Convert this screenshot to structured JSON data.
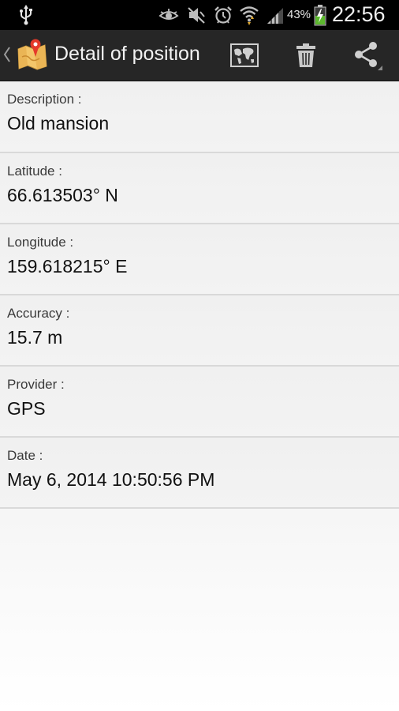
{
  "status_bar": {
    "battery_percent": "43%",
    "time": "22:56",
    "icons": [
      "usb-icon",
      "eye-icon",
      "mute-icon",
      "alarm-icon",
      "wifi-icon",
      "signal-icon",
      "battery-icon"
    ]
  },
  "action_bar": {
    "title": "Detail of position",
    "actions": [
      "map-icon",
      "trash-icon",
      "share-icon"
    ]
  },
  "details": [
    {
      "label": "Description :",
      "value": "Old mansion"
    },
    {
      "label": "Latitude :",
      "value": "66.613503° N"
    },
    {
      "label": "Longitude :",
      "value": "159.618215° E"
    },
    {
      "label": "Accuracy :",
      "value": "15.7 m"
    },
    {
      "label": "Provider :",
      "value": "GPS"
    },
    {
      "label": "Date :",
      "value": "May 6, 2014 10:50:56 PM"
    }
  ],
  "colors": {
    "status_bar_bg": "#000000",
    "action_bar_bg": "#262626",
    "battery_fill": "#5cb82e"
  }
}
